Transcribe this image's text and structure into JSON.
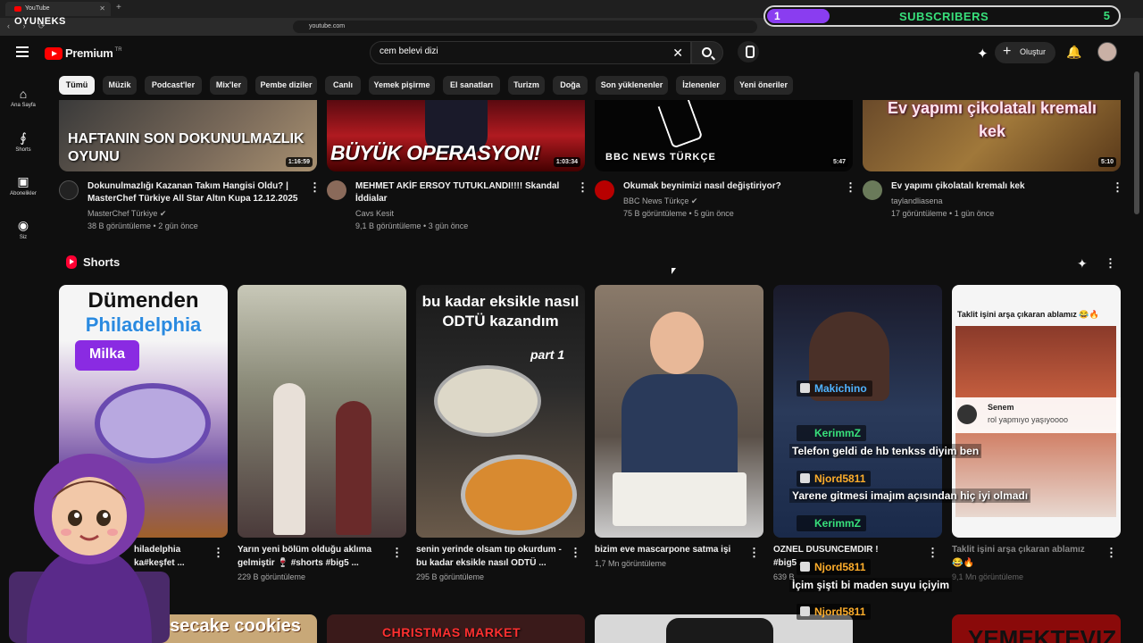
{
  "browser": {
    "tab_title": "YouTube",
    "url": "youtube.com",
    "overlay_logo": "OYUNEKS"
  },
  "subscribers_widget": {
    "left_value": "1",
    "label": "SUBSCRIBERS",
    "right_value": "5"
  },
  "header": {
    "brand": "Premium",
    "region": "TR",
    "search_value": "cem belevi dizi",
    "create_label": "Oluştur"
  },
  "sidebar": {
    "items": [
      {
        "label": "Ana Sayfa",
        "icon": "home-icon"
      },
      {
        "label": "Shorts",
        "icon": "shorts-icon"
      },
      {
        "label": "Abonelikler",
        "icon": "subscriptions-icon"
      },
      {
        "label": "Siz",
        "icon": "account-icon"
      }
    ]
  },
  "chips": [
    "Tümü",
    "Müzik",
    "Podcast'ler",
    "Mix'ler",
    "Pembe diziler",
    "Canlı",
    "Yemek pişirme",
    "El sanatları",
    "Turizm",
    "Doğa",
    "Son yüklenenler",
    "İzlenenler",
    "Yeni öneriler"
  ],
  "videos": [
    {
      "thumb_text": "HAFTANIN SON DOKUNULMAZLIK OYUNU",
      "duration": "1:16:59",
      "title_line1": "Dokunulmazlığı Kazanan Takım Hangisi Oldu? |",
      "title_line2": "MasterChef Türkiye All Star Altın Kupa 12.12.2025",
      "channel": "MasterChef Türkiye",
      "views": "38 B görüntüleme",
      "age": "2 gün önce"
    },
    {
      "thumb_text": "BÜYÜK OPERASYON!",
      "duration": "1:03:34",
      "title_line1": "MEHMET AKİF ERSOY TUTUKLANDI!!!! Skandal",
      "title_line2": "İddialar",
      "channel": "Cavs Kesit",
      "views": "9,1 B görüntüleme",
      "age": "3 gün önce"
    },
    {
      "thumb_text": "BBC NEWS TÜRKÇE",
      "duration": "5:47",
      "title_line1": "Okumak beynimizi nasıl değiştiriyor?",
      "title_line2": "",
      "channel": "BBC News Türkçe",
      "views": "75 B görüntüleme",
      "age": "5 gün önce"
    },
    {
      "thumb_text": "Ev yapımı çikolatalı kremalı kek",
      "duration": "5:10",
      "title_line1": "Ev yapımı çikolatalı kremalı kek",
      "title_line2": "",
      "channel": "taylandliasena",
      "views": "17 görüntüleme",
      "age": "1 gün önce"
    }
  ],
  "shorts": {
    "heading": "Shorts",
    "items": [
      {
        "thumb_title": "Dümenden",
        "thumb_sub": "Philadelphia",
        "thumb_badge": "Milka",
        "title_line1": "hiladelphia",
        "title_line2": "ka#keşfet ...",
        "views": ""
      },
      {
        "thumb_title": "",
        "thumb_sub": "",
        "thumb_badge": "",
        "title_line1": "Yarın yeni bölüm olduğu aklıma",
        "title_line2": "gelmiştir 🍷 #shorts #big5 ...",
        "views": "229 B görüntüleme"
      },
      {
        "thumb_title": "bu kadar eksikle nasıl ODTÜ kazandım",
        "thumb_sub": "part 1",
        "thumb_badge": "",
        "title_line1": "senin yerinde olsam tıp okurdum -",
        "title_line2": "bu kadar eksikle nasıl ODTÜ ...",
        "views": "295 B görüntüleme"
      },
      {
        "thumb_title": "",
        "thumb_sub": "",
        "thumb_badge": "",
        "title_line1": "bizim eve mascarpone satma işi",
        "title_line2": "",
        "views": "1,7 Mn görüntüleme"
      },
      {
        "thumb_title": "",
        "thumb_sub": "",
        "thumb_badge": "",
        "title_line1": "OZNEL DUSUNCEMDIR !",
        "title_line2": "#big5 ...",
        "views": "639 B"
      },
      {
        "thumb_title": "Taklit işini arşa çıkaran ablamız 😂🔥",
        "thumb_sub": "",
        "thumb_badge": "",
        "title_line1": "Taklit işini arşa çıkaran ablamız",
        "title_line2": "😂🔥",
        "views": "9,1 Mn görüntüleme"
      }
    ]
  },
  "chat": [
    {
      "user": "Makichino",
      "color": "#4fb3ff",
      "message": ""
    },
    {
      "user": "KerimmZ",
      "color": "#38e07b",
      "message": "Telefon geldi de hb tenkss diyim ben"
    },
    {
      "user": "Njord5811",
      "color": "#ffae2b",
      "message": "Yarene gitmesi imajım açısından hiç iyi olmadı"
    },
    {
      "user": "KerimmZ",
      "color": "#38e07b",
      "message": ""
    },
    {
      "user": "Njord5811",
      "color": "#ffae2b",
      "message": "İçim şişti bi maden suyu içiyim"
    },
    {
      "user": "Njord5811",
      "color": "#ffae2b",
      "message": ""
    }
  ],
  "popup_comment": {
    "user": "Senem",
    "text": "rol yapmıyo yaşıyoooo"
  },
  "bottom_row": [
    "esecake cookies",
    "CHRISTMAS MARKET",
    "",
    "YEMEKTEVIZ"
  ]
}
